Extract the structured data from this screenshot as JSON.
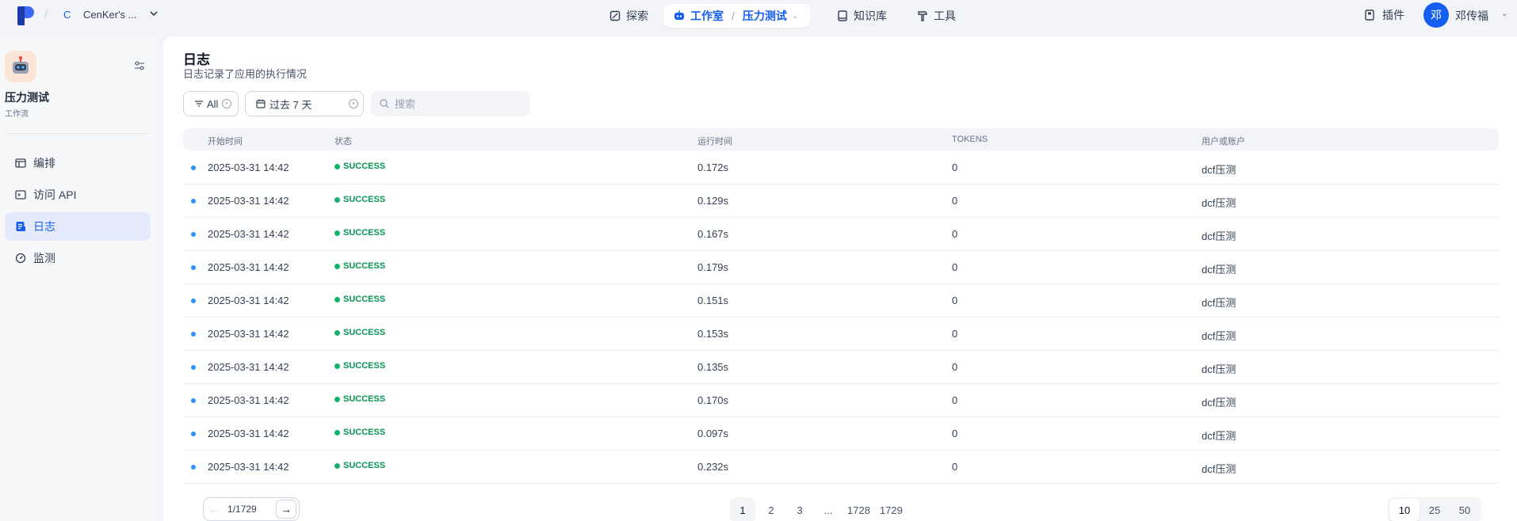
{
  "topbar": {
    "workspace_initial": "C",
    "workspace_name": "CenKer's ...",
    "nav_explore": "探索",
    "nav_studio": "工作室",
    "nav_current_app": "压力测试",
    "nav_knowledge": "知识库",
    "nav_tools": "工具",
    "plugins": "插件",
    "avatar_initial": "邓",
    "user_name": "邓传福"
  },
  "sidebar": {
    "app_name": "压力测试",
    "app_type": "工作流",
    "items": [
      {
        "label": "编排",
        "icon": "layout-icon"
      },
      {
        "label": "访问 API",
        "icon": "terminal-icon"
      },
      {
        "label": "日志",
        "icon": "log-icon"
      },
      {
        "label": "监测",
        "icon": "monitor-icon"
      }
    ],
    "active_index": 2
  },
  "main": {
    "title": "日志",
    "subtitle": "日志记录了应用的执行情况",
    "filters": {
      "status": "All",
      "date": "过去 7 天",
      "search_placeholder": "搜索",
      "search_value": ""
    },
    "table": {
      "headers": [
        "开始时间",
        "状态",
        "运行时间",
        "TOKENS",
        "用户或账户"
      ],
      "rows": [
        {
          "start": "2025-03-31 14:42",
          "status": "SUCCESS",
          "runtime": "0.172s",
          "tokens": "0",
          "user": "dcf压测"
        },
        {
          "start": "2025-03-31 14:42",
          "status": "SUCCESS",
          "runtime": "0.129s",
          "tokens": "0",
          "user": "dcf压测"
        },
        {
          "start": "2025-03-31 14:42",
          "status": "SUCCESS",
          "runtime": "0.167s",
          "tokens": "0",
          "user": "dcf压测"
        },
        {
          "start": "2025-03-31 14:42",
          "status": "SUCCESS",
          "runtime": "0.179s",
          "tokens": "0",
          "user": "dcf压测"
        },
        {
          "start": "2025-03-31 14:42",
          "status": "SUCCESS",
          "runtime": "0.151s",
          "tokens": "0",
          "user": "dcf压测"
        },
        {
          "start": "2025-03-31 14:42",
          "status": "SUCCESS",
          "runtime": "0.153s",
          "tokens": "0",
          "user": "dcf压测"
        },
        {
          "start": "2025-03-31 14:42",
          "status": "SUCCESS",
          "runtime": "0.135s",
          "tokens": "0",
          "user": "dcf压测"
        },
        {
          "start": "2025-03-31 14:42",
          "status": "SUCCESS",
          "runtime": "0.170s",
          "tokens": "0",
          "user": "dcf压测"
        },
        {
          "start": "2025-03-31 14:42",
          "status": "SUCCESS",
          "runtime": "0.097s",
          "tokens": "0",
          "user": "dcf压测"
        },
        {
          "start": "2025-03-31 14:42",
          "status": "SUCCESS",
          "runtime": "0.232s",
          "tokens": "0",
          "user": "dcf压测"
        }
      ]
    },
    "pagination": {
      "current": "1",
      "slash": "/",
      "total": "1729",
      "pages": [
        "1",
        "2",
        "3",
        "...",
        "1728",
        "1729"
      ],
      "active_page": "1",
      "page_sizes": [
        "10",
        "25",
        "50"
      ],
      "active_size": "10"
    }
  },
  "colors": {
    "accent": "#155eef",
    "success": "#17b26a",
    "background": "#f2f4f7"
  }
}
